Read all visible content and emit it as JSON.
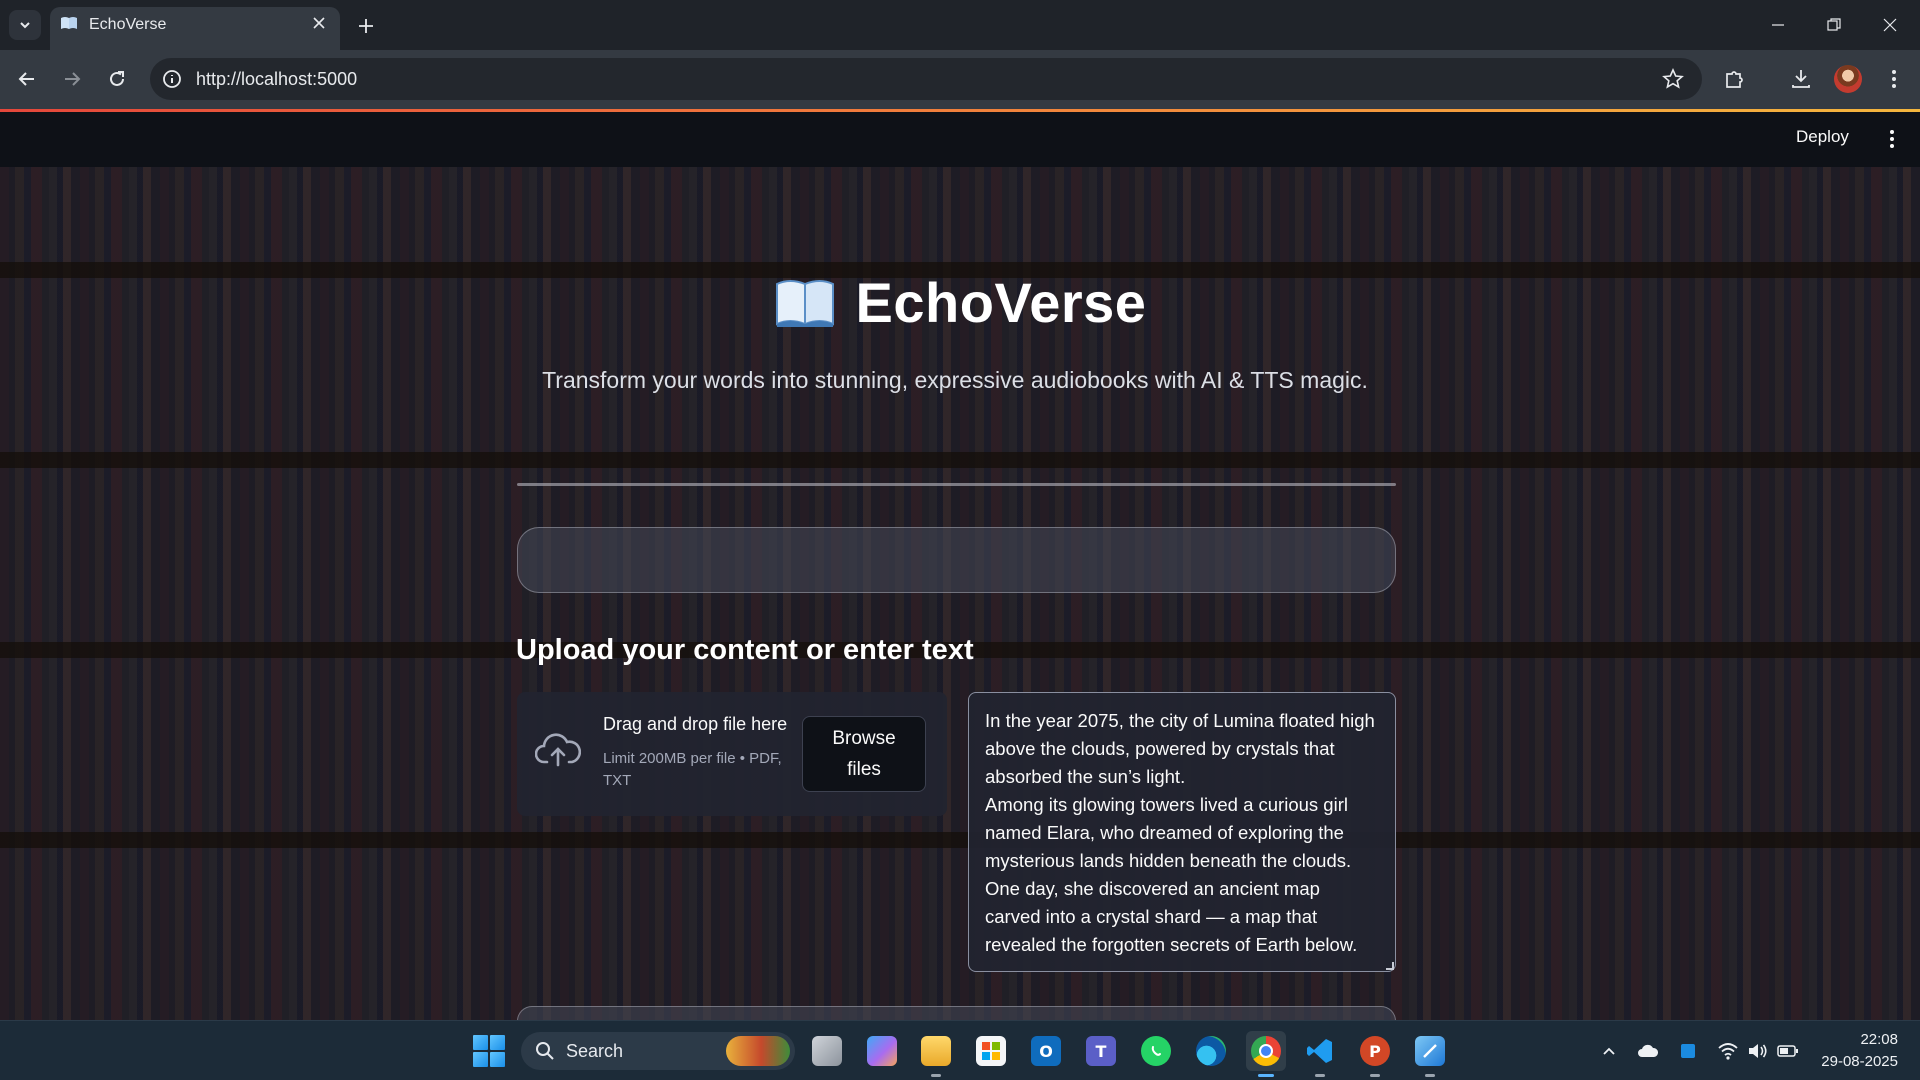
{
  "browser": {
    "tab_title": "EchoVerse",
    "url": "http://localhost:5000",
    "accent_gradient": [
      "#e4473b",
      "#f07b3c",
      "#f4b63e"
    ]
  },
  "app": {
    "header": {
      "deploy_label": "Deploy"
    },
    "title": "EchoVerse",
    "tagline": "Transform your words into stunning, expressive audiobooks with AI & TTS magic.",
    "section_heading": "Upload your content or enter text",
    "uploader": {
      "drag_text": "Drag and drop file here",
      "limit_text": "Limit 200MB per file • PDF, TXT",
      "browse_label": "Browse files"
    },
    "text_input": {
      "value": "In the year 2075, the city of Lumina floated high above the clouds, powered by crystals that absorbed the sun’s light.\nAmong its glowing towers lived a curious girl named Elara, who dreamed of exploring the mysterious lands hidden beneath the clouds.\nOne day, she discovered an ancient map carved into a crystal shard — a map that revealed the forgotten secrets of Earth below."
    },
    "colors": {
      "header_bg": "#0e1117",
      "widget_bg": "#222430"
    }
  },
  "taskbar": {
    "search_label": "Search",
    "apps": [
      {
        "name": "task-view",
        "icon": "task-view-icon"
      },
      {
        "name": "copilot",
        "icon": "copilot-icon"
      },
      {
        "name": "file-explorer",
        "icon": "folder-icon"
      },
      {
        "name": "microsoft-store",
        "icon": "store-icon"
      },
      {
        "name": "outlook",
        "icon": "outlook-icon"
      },
      {
        "name": "teams",
        "icon": "teams-icon"
      },
      {
        "name": "whatsapp",
        "icon": "whatsapp-icon"
      },
      {
        "name": "edge",
        "icon": "edge-icon"
      },
      {
        "name": "chrome",
        "icon": "chrome-icon"
      },
      {
        "name": "vscode",
        "icon": "vscode-icon"
      },
      {
        "name": "powerpoint",
        "icon": "powerpoint-icon"
      },
      {
        "name": "snipping-tool",
        "icon": "snipping-tool-icon"
      }
    ],
    "clock": {
      "time": "22:08",
      "date": "29-08-2025"
    }
  }
}
